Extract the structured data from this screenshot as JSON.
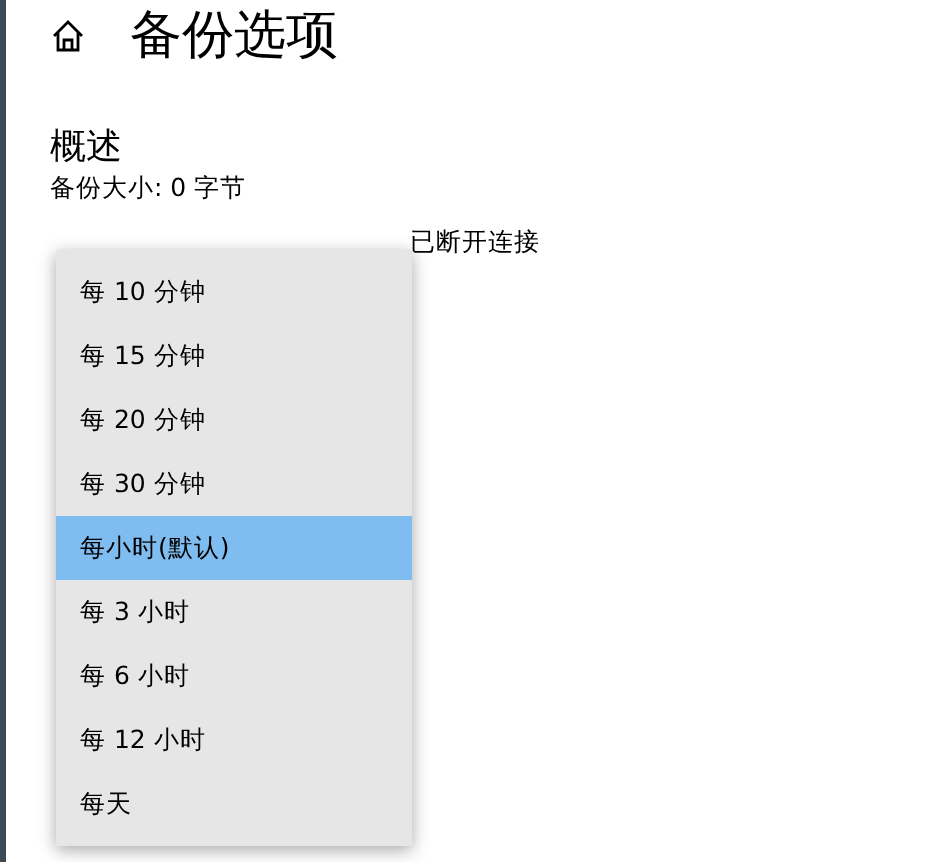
{
  "header": {
    "title": "备份选项"
  },
  "overview": {
    "heading": "概述",
    "size": "备份大小: 0 字节",
    "status": "已断开连接"
  },
  "dropdown": {
    "options": [
      {
        "label": "每 10 分钟",
        "selected": false
      },
      {
        "label": "每 15 分钟",
        "selected": false
      },
      {
        "label": "每 20 分钟",
        "selected": false
      },
      {
        "label": "每 30 分钟",
        "selected": false
      },
      {
        "label": "每小时(默认)",
        "selected": true
      },
      {
        "label": "每 3 小时",
        "selected": false
      },
      {
        "label": "每 6 小时",
        "selected": false
      },
      {
        "label": "每 12 小时",
        "selected": false
      },
      {
        "label": "每天",
        "selected": false
      }
    ]
  }
}
